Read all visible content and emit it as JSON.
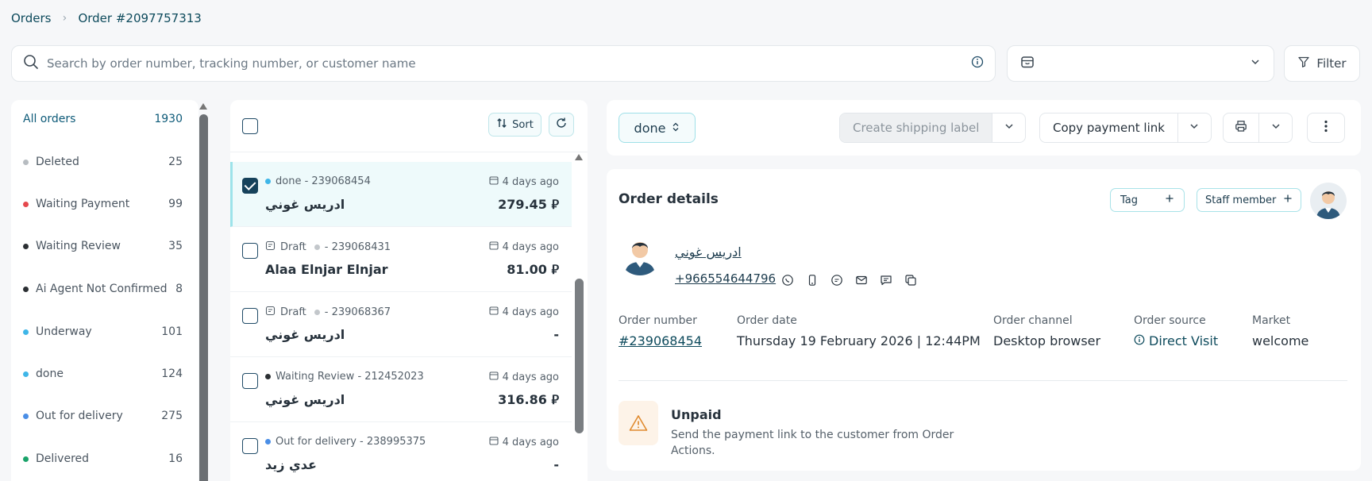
{
  "breadcrumb": {
    "root": "Orders",
    "current": "Order #2097757313",
    "separator": "›"
  },
  "search": {
    "placeholder": "Search by order number, tracking number, or customer name"
  },
  "store_select": {
    "value": ""
  },
  "filter": {
    "label": "Filter"
  },
  "statuses": [
    {
      "label": "All orders",
      "count": "1930",
      "color": ""
    },
    {
      "label": "Deleted",
      "count": "25",
      "color": "#b7bcc1"
    },
    {
      "label": "Waiting Payment",
      "count": "99",
      "color": "#e5484d"
    },
    {
      "label": "Waiting Review",
      "count": "35",
      "color": "#2b2f33"
    },
    {
      "label": "Ai Agent Not Confirmed",
      "count": "8",
      "color": "#2b2f33"
    },
    {
      "label": "Underway",
      "count": "101",
      "color": "#3fb6e8"
    },
    {
      "label": "done",
      "count": "124",
      "color": "#3fb6e8"
    },
    {
      "label": "Out for delivery",
      "count": "275",
      "color": "#4a8ee6"
    },
    {
      "label": "Delivered",
      "count": "16",
      "color": "#1aa36a"
    }
  ],
  "list": {
    "sort_label": "Sort",
    "orders": [
      {
        "status": "done - 239068454",
        "status_color": "#3fb6e8",
        "is_draft": false,
        "when": "4 days ago",
        "name": "ادريس غوني",
        "amount": "279.45",
        "selected": true
      },
      {
        "draft_label": "Draft",
        "status": "- 239068431",
        "status_color": "#c3c7cb",
        "is_draft": true,
        "when": "4 days ago",
        "name": "Alaa Elnjar Elnjar",
        "amount": "81.00",
        "selected": false
      },
      {
        "draft_label": "Draft",
        "status": "- 239068367",
        "status_color": "#c3c7cb",
        "is_draft": true,
        "when": "4 days ago",
        "name": "ادريس غوني",
        "amount": "-",
        "selected": false
      },
      {
        "status": "Waiting Review - 212452023",
        "status_color": "#2b2f33",
        "is_draft": false,
        "when": "4 days ago",
        "name": "ادريس غوني",
        "amount": "316.86",
        "selected": false
      },
      {
        "status": "Out for delivery - 238995375",
        "status_color": "#4a8ee6",
        "is_draft": false,
        "when": "4 days ago",
        "name": "عدي زيد",
        "amount": "-",
        "selected": false
      }
    ]
  },
  "actions": {
    "status": "done",
    "create_label": "Create shipping label",
    "copy_link": "Copy payment link"
  },
  "details": {
    "title": "Order details",
    "tag": "Tag",
    "staff": "Staff member",
    "customer_name": "ادريس غوني",
    "customer_phone": "+966554644796",
    "fields": {
      "order_number": {
        "label": "Order number",
        "value": "#239068454"
      },
      "order_date": {
        "label": "Order date",
        "value": "Thursday 19 February 2026 | 12:44PM"
      },
      "order_channel": {
        "label": "Order channel",
        "value": "Desktop browser"
      },
      "order_source": {
        "label": "Order source",
        "value": "Direct Visit"
      },
      "market": {
        "label": "Market",
        "value": "welcome"
      }
    },
    "payment": {
      "title": "Unpaid",
      "desc": "Send the payment link to the customer from Order Actions."
    }
  }
}
